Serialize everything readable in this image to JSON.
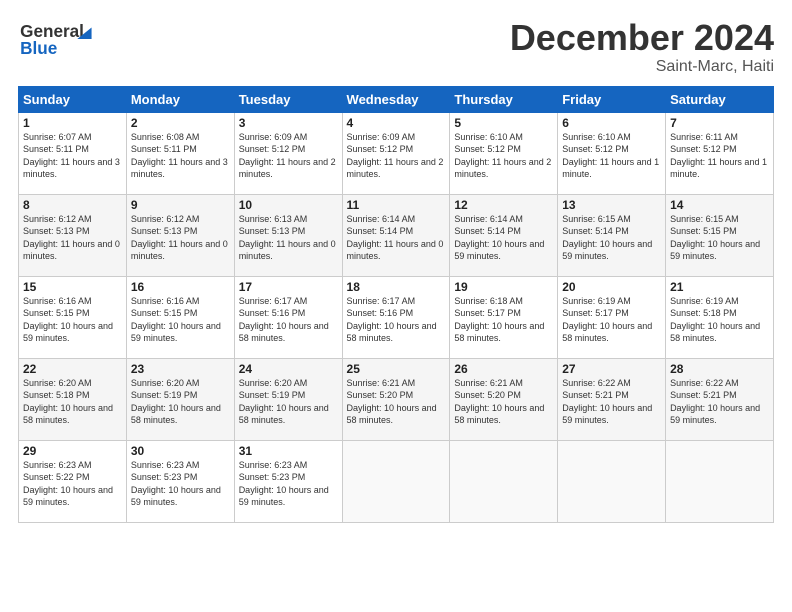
{
  "header": {
    "logo_line1": "General",
    "logo_line2": "Blue",
    "month": "December 2024",
    "location": "Saint-Marc, Haiti"
  },
  "days_of_week": [
    "Sunday",
    "Monday",
    "Tuesday",
    "Wednesday",
    "Thursday",
    "Friday",
    "Saturday"
  ],
  "weeks": [
    [
      {
        "day": "1",
        "sunrise": "6:07 AM",
        "sunset": "5:11 PM",
        "daylight": "11 hours and 3 minutes."
      },
      {
        "day": "2",
        "sunrise": "6:08 AM",
        "sunset": "5:11 PM",
        "daylight": "11 hours and 3 minutes."
      },
      {
        "day": "3",
        "sunrise": "6:09 AM",
        "sunset": "5:12 PM",
        "daylight": "11 hours and 2 minutes."
      },
      {
        "day": "4",
        "sunrise": "6:09 AM",
        "sunset": "5:12 PM",
        "daylight": "11 hours and 2 minutes."
      },
      {
        "day": "5",
        "sunrise": "6:10 AM",
        "sunset": "5:12 PM",
        "daylight": "11 hours and 2 minutes."
      },
      {
        "day": "6",
        "sunrise": "6:10 AM",
        "sunset": "5:12 PM",
        "daylight": "11 hours and 1 minute."
      },
      {
        "day": "7",
        "sunrise": "6:11 AM",
        "sunset": "5:12 PM",
        "daylight": "11 hours and 1 minute."
      }
    ],
    [
      {
        "day": "8",
        "sunrise": "6:12 AM",
        "sunset": "5:13 PM",
        "daylight": "11 hours and 0 minutes."
      },
      {
        "day": "9",
        "sunrise": "6:12 AM",
        "sunset": "5:13 PM",
        "daylight": "11 hours and 0 minutes."
      },
      {
        "day": "10",
        "sunrise": "6:13 AM",
        "sunset": "5:13 PM",
        "daylight": "11 hours and 0 minutes."
      },
      {
        "day": "11",
        "sunrise": "6:14 AM",
        "sunset": "5:14 PM",
        "daylight": "11 hours and 0 minutes."
      },
      {
        "day": "12",
        "sunrise": "6:14 AM",
        "sunset": "5:14 PM",
        "daylight": "10 hours and 59 minutes."
      },
      {
        "day": "13",
        "sunrise": "6:15 AM",
        "sunset": "5:14 PM",
        "daylight": "10 hours and 59 minutes."
      },
      {
        "day": "14",
        "sunrise": "6:15 AM",
        "sunset": "5:15 PM",
        "daylight": "10 hours and 59 minutes."
      }
    ],
    [
      {
        "day": "15",
        "sunrise": "6:16 AM",
        "sunset": "5:15 PM",
        "daylight": "10 hours and 59 minutes."
      },
      {
        "day": "16",
        "sunrise": "6:16 AM",
        "sunset": "5:15 PM",
        "daylight": "10 hours and 59 minutes."
      },
      {
        "day": "17",
        "sunrise": "6:17 AM",
        "sunset": "5:16 PM",
        "daylight": "10 hours and 58 minutes."
      },
      {
        "day": "18",
        "sunrise": "6:17 AM",
        "sunset": "5:16 PM",
        "daylight": "10 hours and 58 minutes."
      },
      {
        "day": "19",
        "sunrise": "6:18 AM",
        "sunset": "5:17 PM",
        "daylight": "10 hours and 58 minutes."
      },
      {
        "day": "20",
        "sunrise": "6:19 AM",
        "sunset": "5:17 PM",
        "daylight": "10 hours and 58 minutes."
      },
      {
        "day": "21",
        "sunrise": "6:19 AM",
        "sunset": "5:18 PM",
        "daylight": "10 hours and 58 minutes."
      }
    ],
    [
      {
        "day": "22",
        "sunrise": "6:20 AM",
        "sunset": "5:18 PM",
        "daylight": "10 hours and 58 minutes."
      },
      {
        "day": "23",
        "sunrise": "6:20 AM",
        "sunset": "5:19 PM",
        "daylight": "10 hours and 58 minutes."
      },
      {
        "day": "24",
        "sunrise": "6:20 AM",
        "sunset": "5:19 PM",
        "daylight": "10 hours and 58 minutes."
      },
      {
        "day": "25",
        "sunrise": "6:21 AM",
        "sunset": "5:20 PM",
        "daylight": "10 hours and 58 minutes."
      },
      {
        "day": "26",
        "sunrise": "6:21 AM",
        "sunset": "5:20 PM",
        "daylight": "10 hours and 58 minutes."
      },
      {
        "day": "27",
        "sunrise": "6:22 AM",
        "sunset": "5:21 PM",
        "daylight": "10 hours and 59 minutes."
      },
      {
        "day": "28",
        "sunrise": "6:22 AM",
        "sunset": "5:21 PM",
        "daylight": "10 hours and 59 minutes."
      }
    ],
    [
      {
        "day": "29",
        "sunrise": "6:23 AM",
        "sunset": "5:22 PM",
        "daylight": "10 hours and 59 minutes."
      },
      {
        "day": "30",
        "sunrise": "6:23 AM",
        "sunset": "5:23 PM",
        "daylight": "10 hours and 59 minutes."
      },
      {
        "day": "31",
        "sunrise": "6:23 AM",
        "sunset": "5:23 PM",
        "daylight": "10 hours and 59 minutes."
      },
      null,
      null,
      null,
      null
    ]
  ]
}
